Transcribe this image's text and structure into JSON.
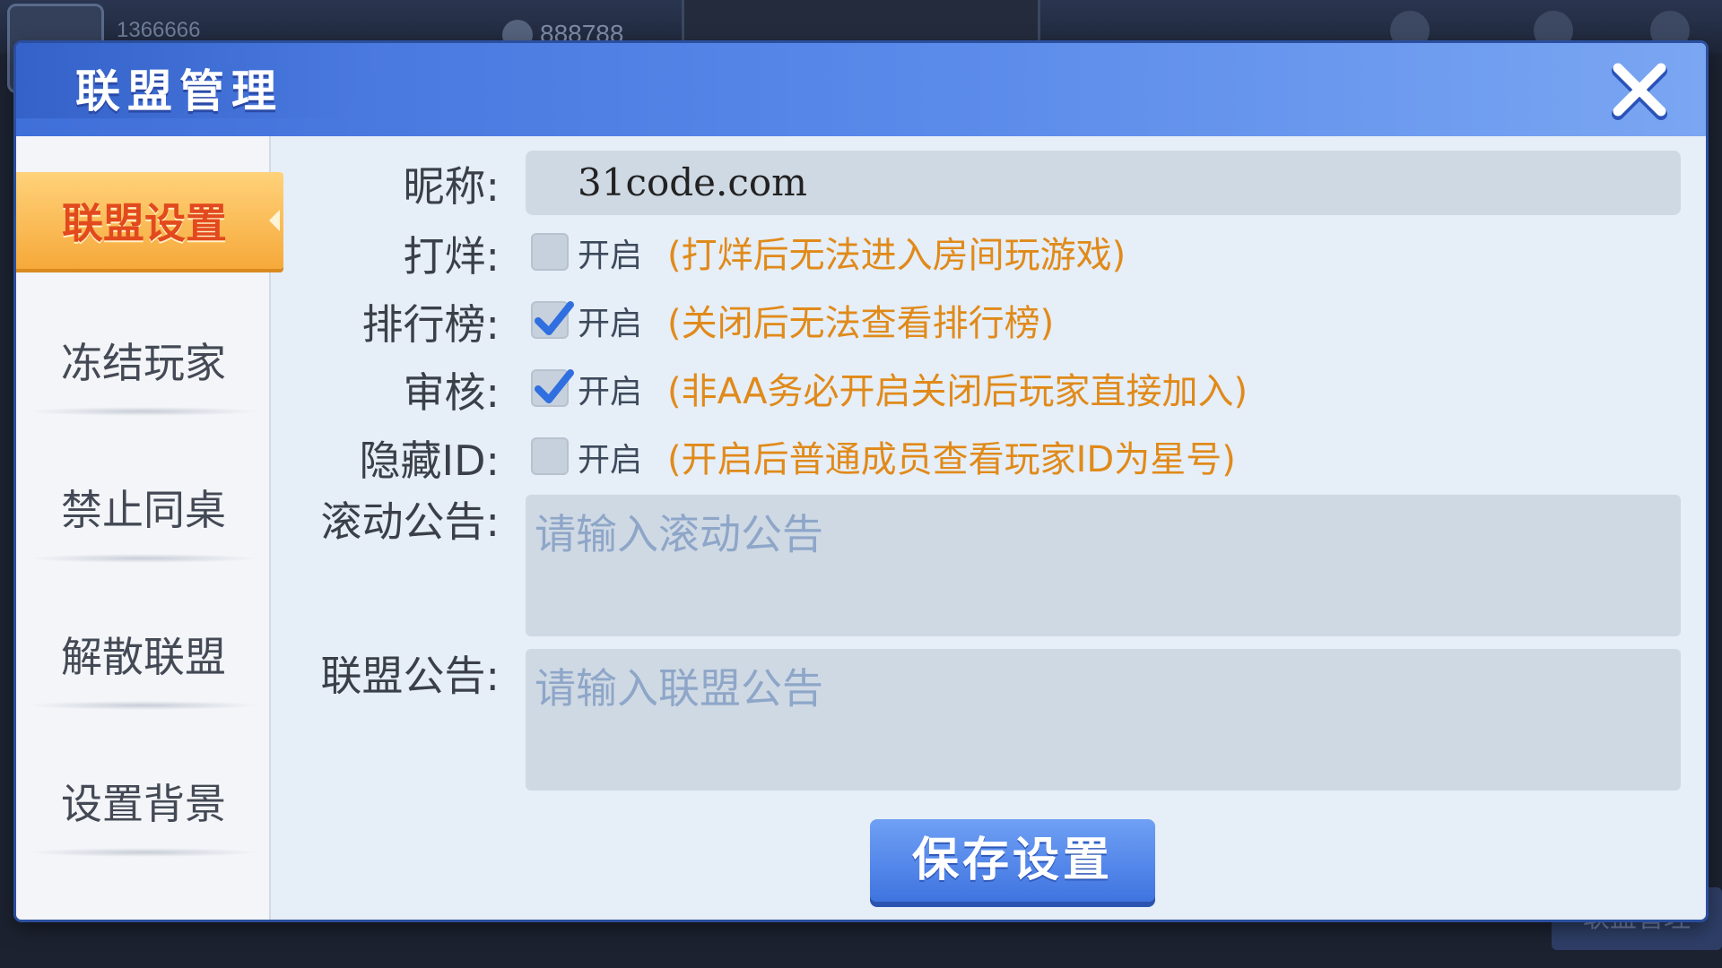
{
  "background": {
    "player_id": "1366666",
    "coins": "888788",
    "bottom_button_label": "联盟管理"
  },
  "dialog": {
    "title": "联盟管理",
    "close_icon": "close-icon"
  },
  "sidebar": {
    "items": [
      {
        "label": "联盟设置",
        "active": true
      },
      {
        "label": "冻结玩家",
        "active": false
      },
      {
        "label": "禁止同桌",
        "active": false
      },
      {
        "label": "解散联盟",
        "active": false
      },
      {
        "label": "设置背景",
        "active": false
      }
    ]
  },
  "form": {
    "nickname": {
      "label": "昵称:",
      "value": "31code.com"
    },
    "toggles": [
      {
        "label": "打烊:",
        "option": "开启",
        "checked": false,
        "hint": "(打烊后无法进入房间玩游戏)"
      },
      {
        "label": "排行榜:",
        "option": "开启",
        "checked": true,
        "hint": "(关闭后无法查看排行榜)"
      },
      {
        "label": "审核:",
        "option": "开启",
        "checked": true,
        "hint": "(非AA务必开启关闭后玩家直接加入)"
      },
      {
        "label": "隐藏ID:",
        "option": "开启",
        "checked": false,
        "hint": "(开启后普通成员查看玩家ID为星号)"
      }
    ],
    "scroll_notice": {
      "label": "滚动公告:",
      "placeholder": "请输入滚动公告"
    },
    "alliance_notice": {
      "label": "联盟公告:",
      "placeholder": "请输入联盟公告"
    },
    "save_label": "保存设置"
  },
  "colors": {
    "header_blue": "#4a7ae0",
    "active_tab_orange": "#f6a93a",
    "active_tab_text": "#e24a1e",
    "hint_orange": "#e08a1a",
    "check_blue": "#2f6fe0",
    "input_bg": "#cfd9e4"
  }
}
